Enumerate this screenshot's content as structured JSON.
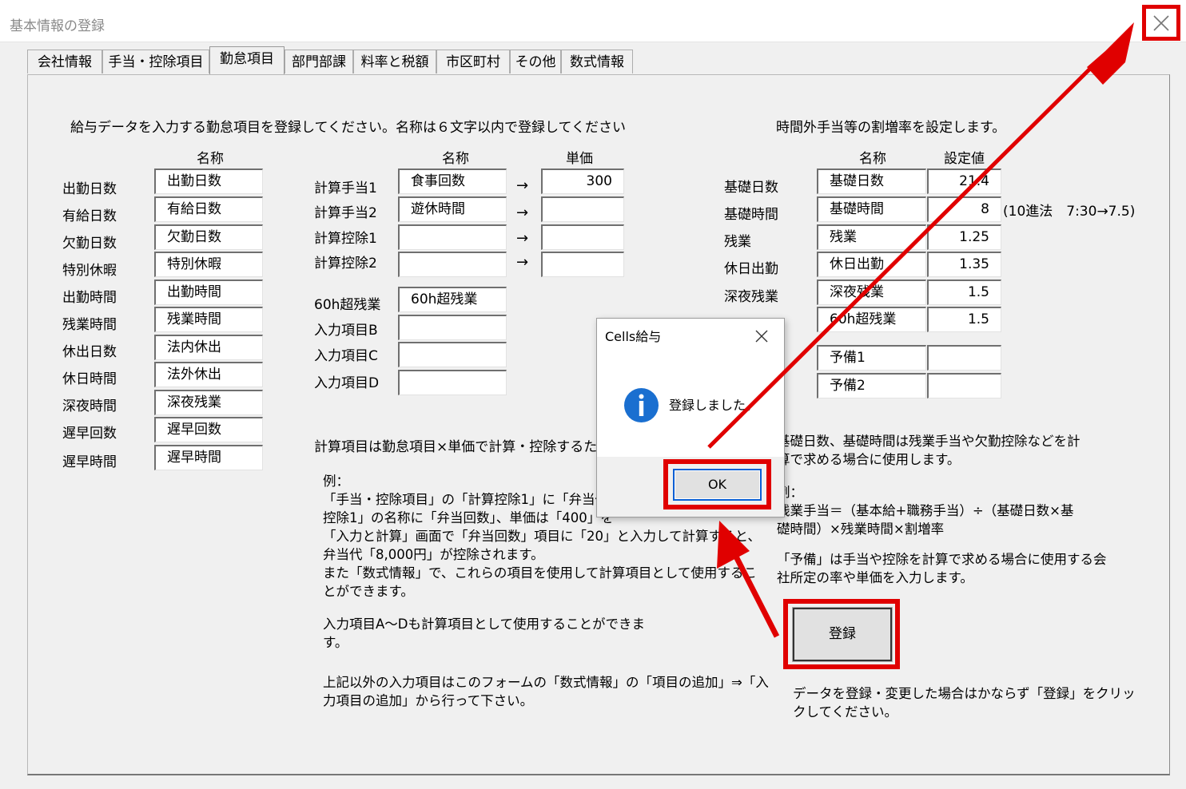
{
  "window": {
    "title": "基本情報の登録"
  },
  "tabs": [
    "会社情報",
    "手当・控除項目",
    "勤怠項目",
    "部門部課",
    "料率と税額",
    "市区町村",
    "その他",
    "数式情報"
  ],
  "left": {
    "instruction": "給与データを入力する勤怠項目を登録してください。名称は６文字以内で登録してください",
    "col_header": "名称",
    "rows": [
      {
        "label": "出勤日数",
        "value": "出勤日数"
      },
      {
        "label": "有給日数",
        "value": "有給日数"
      },
      {
        "label": "欠勤日数",
        "value": "欠勤日数"
      },
      {
        "label": "特別休暇",
        "value": "特別休暇"
      },
      {
        "label": "出勤時間",
        "value": "出勤時間"
      },
      {
        "label": "残業時間",
        "value": "残業時間"
      },
      {
        "label": "休出日数",
        "value": "法内休出"
      },
      {
        "label": "休日時間",
        "value": "法外休出"
      },
      {
        "label": "深夜時間",
        "value": "深夜残業"
      },
      {
        "label": "遅早回数",
        "value": "遅早回数"
      },
      {
        "label": "遅早時間",
        "value": "遅早時間"
      }
    ]
  },
  "middle": {
    "col_name": "名称",
    "col_price": "単価",
    "calc_rows": [
      {
        "label": "計算手当1",
        "name": "食事回数",
        "arrow": "→",
        "price": "300"
      },
      {
        "label": "計算手当2",
        "name": "遊休時間",
        "arrow": "→",
        "price": ""
      },
      {
        "label": "計算控除1",
        "name": "",
        "arrow": "→",
        "price": ""
      },
      {
        "label": "計算控除2",
        "name": "",
        "arrow": "→",
        "price": ""
      }
    ],
    "input_rows": [
      {
        "label": "60h超残業",
        "name": "60h超残業"
      },
      {
        "label": "入力項目B",
        "name": ""
      },
      {
        "label": "入力項目C",
        "name": ""
      },
      {
        "label": "入力項目D",
        "name": ""
      }
    ],
    "note_heading": "計算項目は勤怠項目×単価で計算・控除するた",
    "example_lines": [
      "例：",
      "「手当・控除項目」の「計算控除1」に「弁当代」と",
      "控除1」の名称に「弁当回数」、単価は「400」を",
      "「入力と計算」画面で「弁当回数」項目に「20」と入力して計算すると、",
      "弁当代「8,000円」が控除されます。",
      "また「数式情報」で、これらの項目を使用して計算項目として使用するこ",
      "とができます。"
    ],
    "input_note_lines": [
      "入力項目A～Dも計算項目として使用することができま",
      "す。"
    ],
    "other_note_lines": [
      "上記以外の入力項目はこのフォームの「数式情報」の「項目の追加」⇒「入",
      "力項目の追加」から行って下さい。"
    ]
  },
  "right": {
    "heading": "時間外手当等の割増率を設定します。",
    "col_name": "名称",
    "col_value": "設定値",
    "rows": [
      {
        "label": "基礎日数",
        "name": "基礎日数",
        "value": "21.4"
      },
      {
        "label": "基礎時間",
        "name": "基礎時間",
        "value": "8"
      },
      {
        "label": "残業",
        "name": "残業",
        "value": "1.25"
      },
      {
        "label": "休日出勤",
        "name": "休日出勤",
        "value": "1.35"
      },
      {
        "label": "深夜残業",
        "name": "深夜残業",
        "value": "1.5"
      },
      {
        "label": "",
        "name": "60h超残業",
        "value": "1.5"
      }
    ],
    "spare_rows": [
      {
        "name": "予備1",
        "value": ""
      },
      {
        "name": "予備2",
        "value": ""
      }
    ],
    "hours_note": "(10進法　7:30→7.5)",
    "desc1_lines": [
      "基礎日数、基礎時間は残業手当や欠勤控除などを計",
      "算で求める場合に使用します。"
    ],
    "desc2_lines": [
      "例：",
      "残業手当＝（基本給+職務手当）÷（基礎日数×基",
      "礎時間）×残業時間×割増率"
    ],
    "desc3_lines": [
      "「予備」は手当や控除を計算で求める場合に使用する会",
      "社所定の率や単価を入力します。"
    ],
    "register_button": "登録",
    "register_note_lines": [
      "データを登録・変更した場合はかならず「登録」をクリッ",
      "クしてください。"
    ]
  },
  "dialog": {
    "title": "Cells給与",
    "message": "登録しました。",
    "ok_button": "OK"
  },
  "colors": {
    "annotation_red": "#e00000",
    "info_icon_blue": "#1a6fd0"
  }
}
